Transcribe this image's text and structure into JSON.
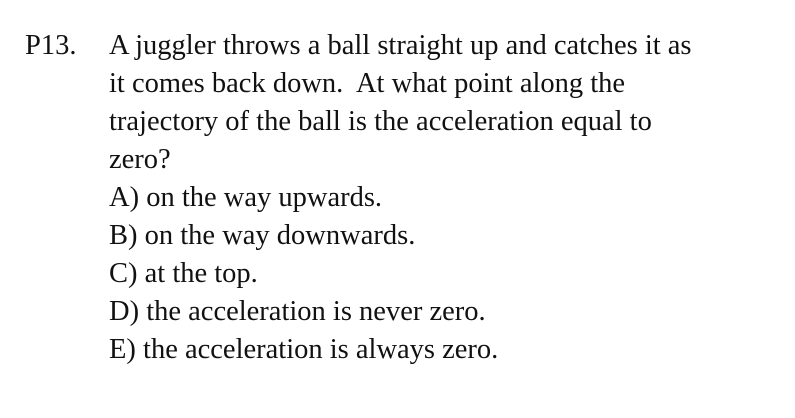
{
  "problem": {
    "number": "P13.",
    "question_lines": [
      "A juggler throws a ball straight up and catches it as",
      "it comes back down.  At what point along the",
      "trajectory of the ball is the acceleration equal to",
      "zero?"
    ],
    "options": [
      "A) on the way upwards.",
      "B) on the way downwards.",
      "C) at the top.",
      "D) the acceleration is never zero.",
      "E) the acceleration is always zero."
    ]
  }
}
